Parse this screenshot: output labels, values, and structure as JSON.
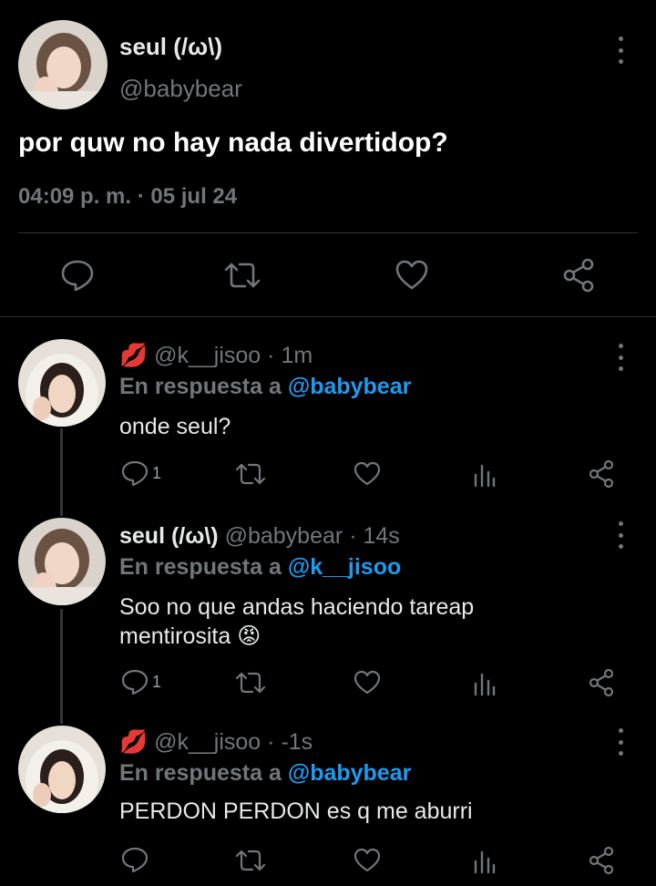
{
  "main_tweet": {
    "name": "seul (/ω\\)",
    "handle": "@babybear",
    "text": "por quw no hay nada divertidop?",
    "timestamp": "04:09 p. m. · 05 jul 24",
    "actions": [
      "reply-icon",
      "retweet-icon",
      "like-icon",
      "share-icon"
    ]
  },
  "replies": [
    {
      "emoji": "💋",
      "name": "",
      "handle": "@k__jisoo",
      "sep": "·",
      "time": "1m",
      "reply_prefix": "En respuesta a",
      "reply_to": "@babybear",
      "text": "onde seul?",
      "reply_count": "1"
    },
    {
      "emoji": "",
      "name": "seul (/ω\\)",
      "handle": "@babybear",
      "sep": "·",
      "time": "14s",
      "reply_prefix": "En respuesta a",
      "reply_to": "@k__jisoo",
      "text": "Soo no que andas haciendo tareap mentirosita 😡",
      "reply_count": "1"
    },
    {
      "emoji": "💋",
      "name": "",
      "handle": "@k__jisoo",
      "sep": "·",
      "time": "-1s",
      "reply_prefix": "En respuesta a",
      "reply_to": "@babybear",
      "text": "PERDON PERDON es q me aburri",
      "reply_count": ""
    }
  ],
  "colors": {
    "background": "#000000",
    "link": "#1d9bf0",
    "muted": "#71767b",
    "text": "#e7e9ea"
  }
}
